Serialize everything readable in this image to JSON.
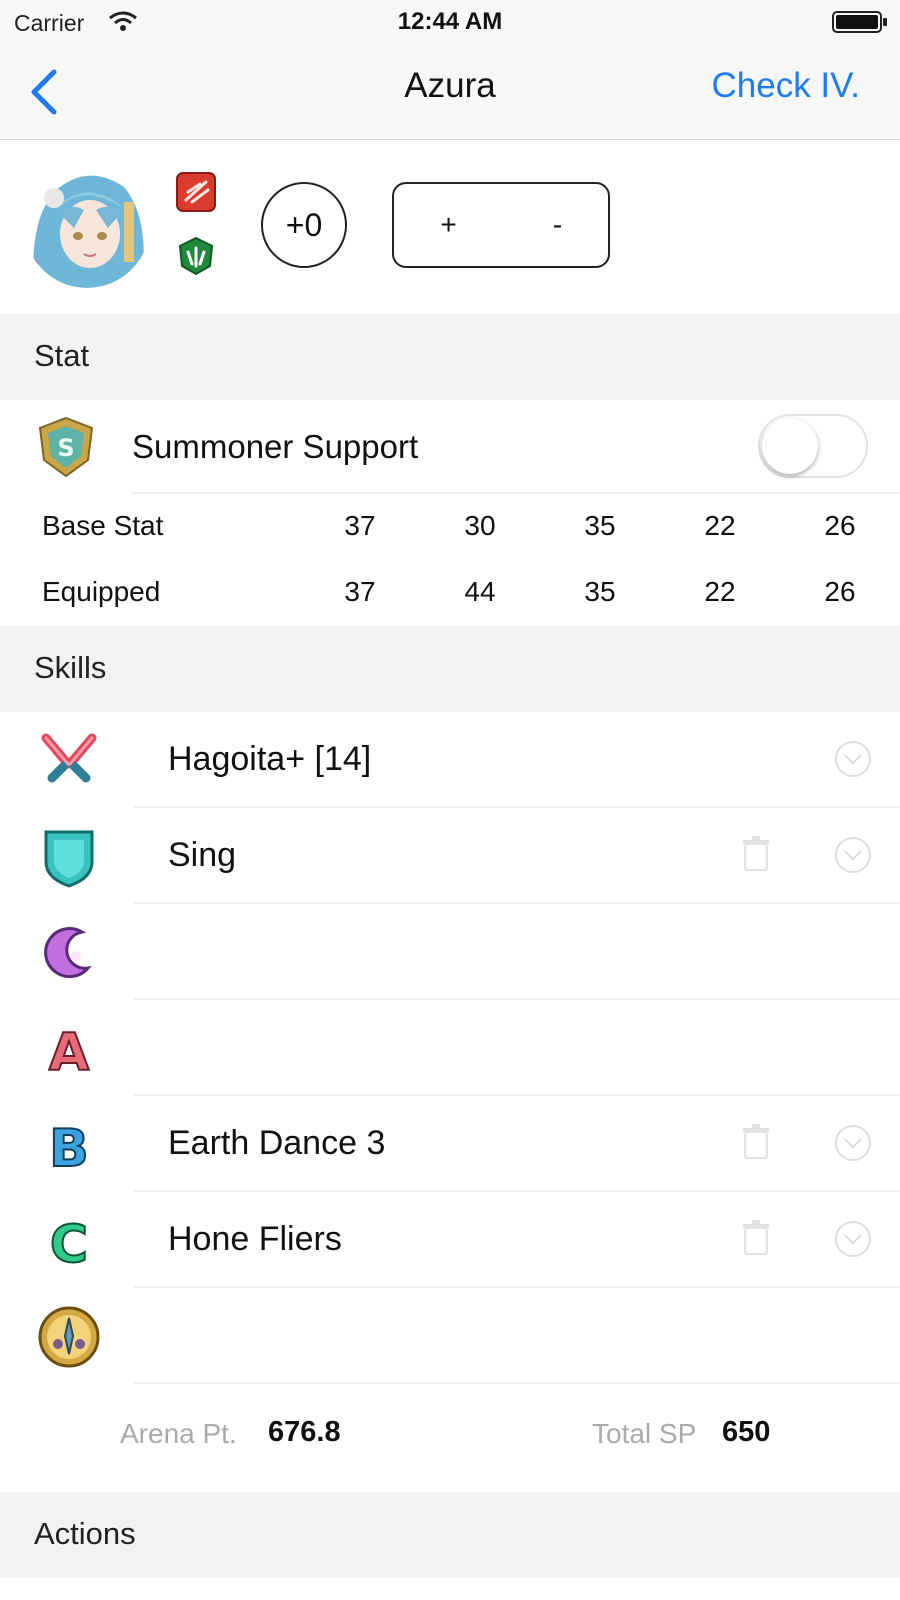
{
  "status_bar": {
    "carrier": "Carrier",
    "time": "12:44 AM"
  },
  "nav": {
    "title": "Azura",
    "right_action": "Check IV."
  },
  "header": {
    "merge_level": "+0",
    "stepper_plus": "+",
    "stepper_minus": "-"
  },
  "sections": {
    "stat": "Stat",
    "skills": "Skills",
    "actions": "Actions"
  },
  "summoner_support": {
    "label": "Summoner Support",
    "enabled": false
  },
  "stats": [
    {
      "label": "Base Stat",
      "values": [
        "37",
        "30",
        "35",
        "22",
        "26"
      ]
    },
    {
      "label": "Equipped",
      "values": [
        "37",
        "44",
        "35",
        "22",
        "26"
      ]
    }
  ],
  "skills": [
    {
      "slot_icon": "weapon-icon",
      "name": "Hagoita+  [14]",
      "trash": false,
      "chevron": true
    },
    {
      "slot_icon": "assist-icon",
      "name": "Sing",
      "trash": true,
      "chevron": true
    },
    {
      "slot_icon": "special-icon",
      "name": "",
      "trash": false,
      "chevron": false
    },
    {
      "slot_icon": "a-skill-icon",
      "name": "",
      "trash": false,
      "chevron": false
    },
    {
      "slot_icon": "b-skill-icon",
      "name": "Earth Dance 3",
      "trash": true,
      "chevron": true
    },
    {
      "slot_icon": "c-skill-icon",
      "name": "Hone Fliers",
      "trash": true,
      "chevron": true
    },
    {
      "slot_icon": "sacred-seal-icon",
      "name": "",
      "trash": false,
      "chevron": false
    }
  ],
  "summary": {
    "arena_label": "Arena Pt.",
    "arena_value": "676.8",
    "sp_label": "Total SP",
    "sp_value": "650"
  },
  "colors": {
    "accent": "#1f7cf0",
    "section_bg": "#f2f2f2",
    "muted_text": "#aaaaaa"
  }
}
